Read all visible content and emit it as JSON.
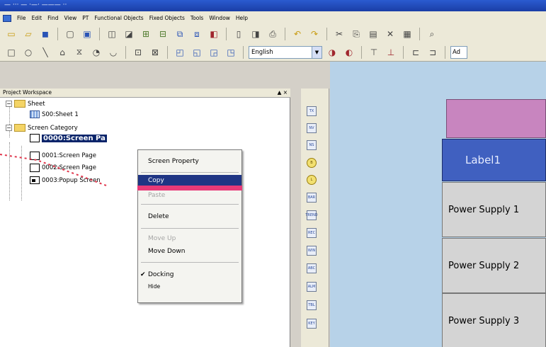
{
  "window": {
    "title": "— ··· — ·—· ——— ··"
  },
  "menubar": {
    "items": [
      "File",
      "Edit",
      "Find",
      "View",
      "PT",
      "Functional Objects",
      "Fixed Objects",
      "Tools",
      "Window",
      "Help"
    ]
  },
  "toolbar2": {
    "language_value": "English",
    "secondary_field": "Ad"
  },
  "workspace": {
    "title": "Project Workspace",
    "controls": "▲ ×",
    "tree": {
      "sheet_folder": "Sheet",
      "sheet_item": "S00:Sheet 1",
      "screen_category": "Screen Category",
      "screens": [
        {
          "label": "0000:Screen Pa",
          "selected": true
        },
        {
          "label": "0001:Screen Page"
        },
        {
          "label": "0002:Screen Page"
        },
        {
          "label": "0003:Popup Screen"
        }
      ]
    }
  },
  "context_menu": {
    "items": [
      {
        "label": "Screen Property",
        "state": "normal"
      },
      {
        "label": "Copy",
        "state": "highlighted"
      },
      {
        "label": "Paste",
        "state": "disabled"
      },
      {
        "label": "Delete",
        "state": "normal"
      },
      {
        "label": "Move Up",
        "state": "disabled"
      },
      {
        "label": "Move Down",
        "state": "normal"
      },
      {
        "label": "Docking",
        "state": "checked"
      },
      {
        "label": "Hide",
        "state": "normal"
      }
    ]
  },
  "palette": {
    "items": [
      "TX",
      "NV",
      "NS",
      "B",
      "L",
      "BAR",
      "TREND",
      "REC",
      "WIN",
      "ABC",
      "ALM",
      "TBL",
      "KEY"
    ]
  },
  "canvas": {
    "label1": "Label1",
    "power_supplies": [
      "Power Supply 1",
      "Power Supply 2",
      "Power Supply 3"
    ]
  },
  "colors": {
    "canvas_bg": "#b7d2e8",
    "label_bg": "#4060c0",
    "header_bg": "#c885bf",
    "arrow": "#e0354b",
    "highlight": "#1f3584"
  }
}
